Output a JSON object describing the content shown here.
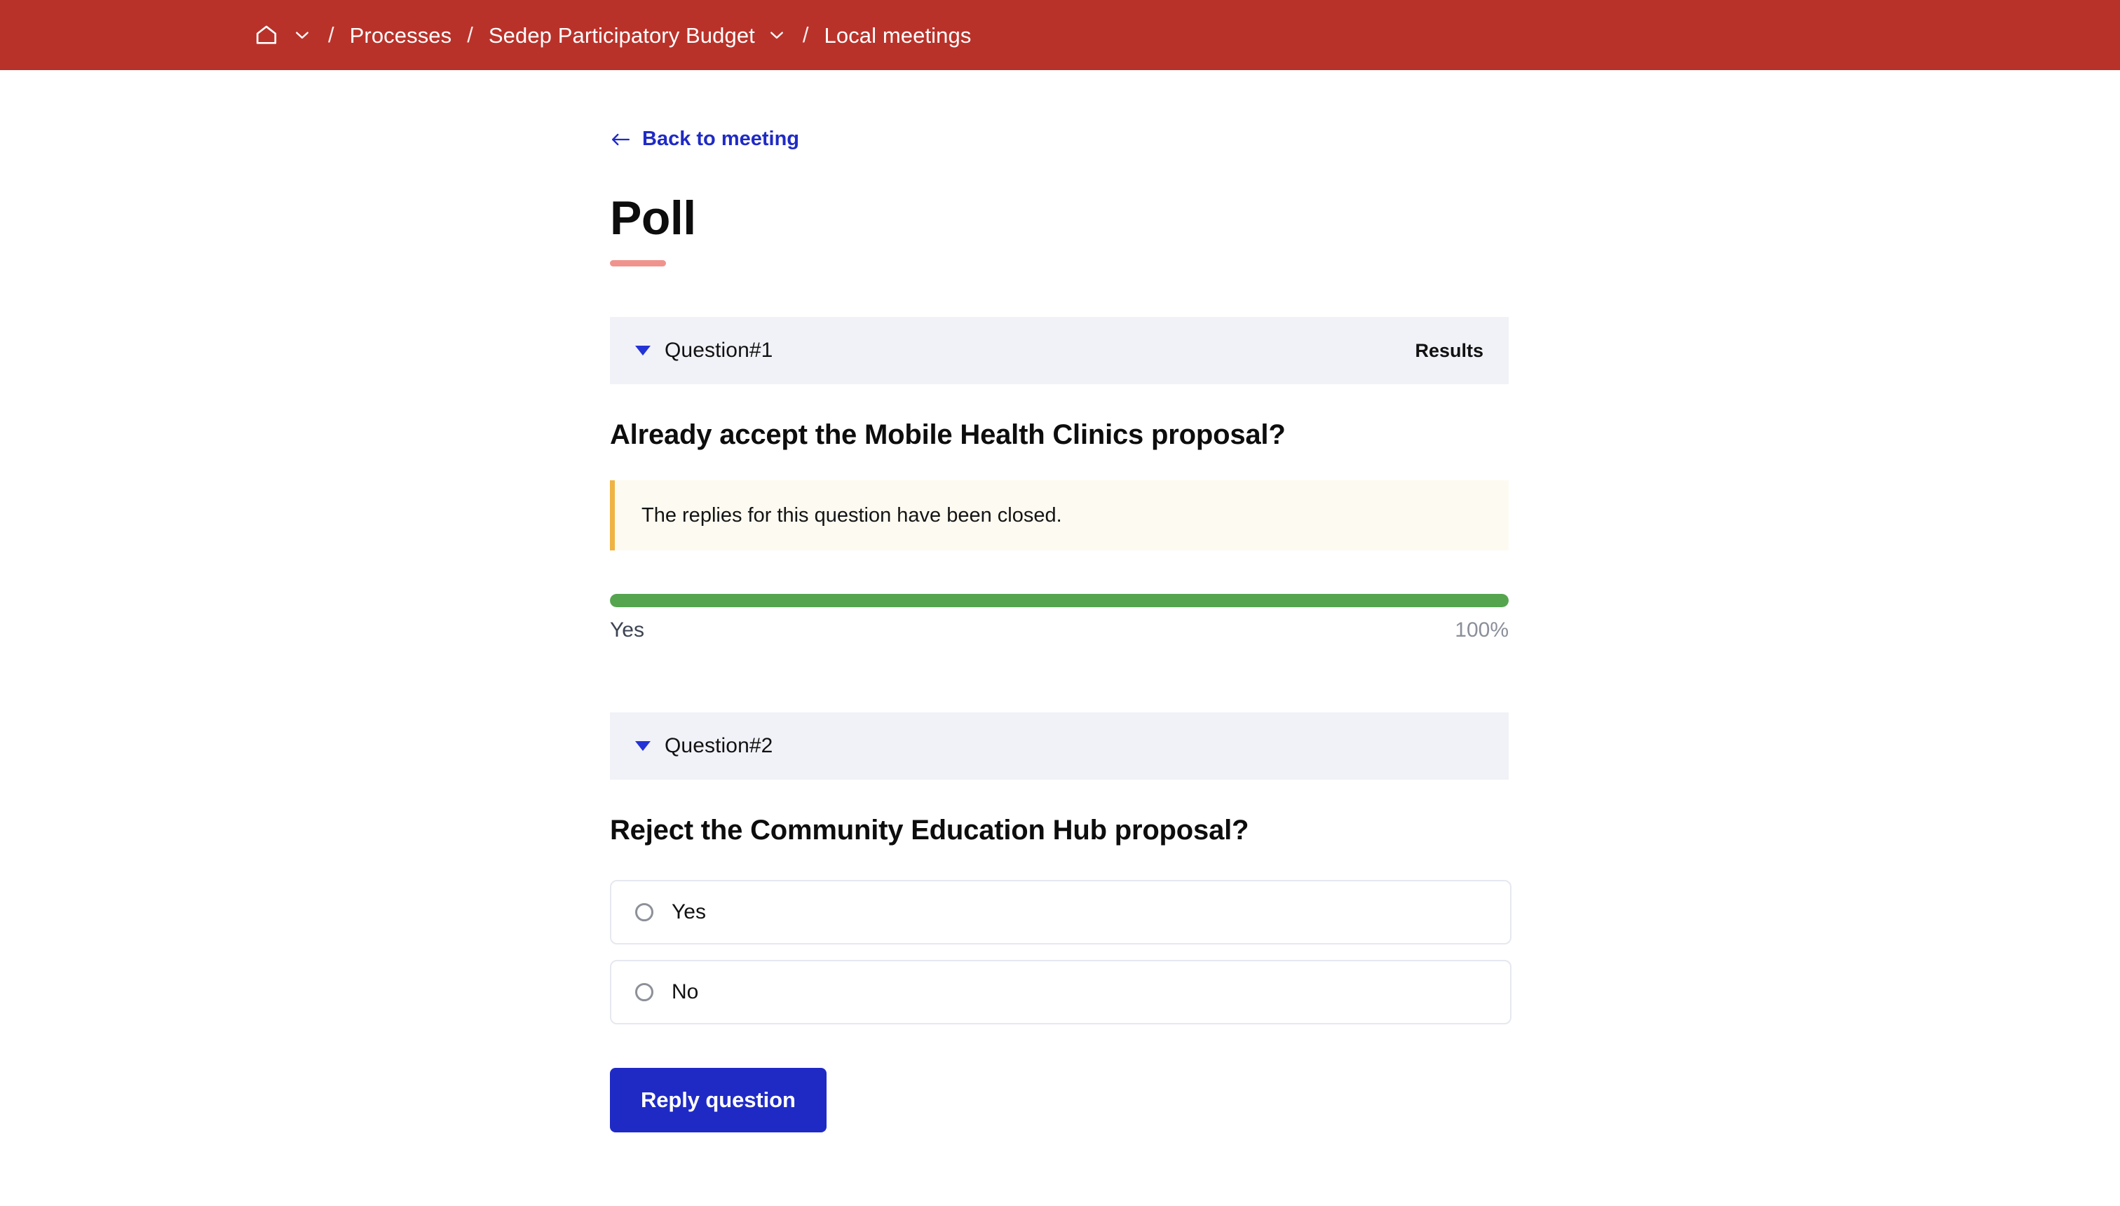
{
  "colors": {
    "nav_background": "#b9322a",
    "accent_link": "#1f2ac5",
    "title_rule": "#f0938c",
    "result_bar": "#55a54f",
    "callout_border": "#efb343",
    "callout_background": "#fdfaf1",
    "question_header_background": "#f1f2f7",
    "primary_button": "#1f2ac5"
  },
  "navbar": {
    "home_icon": "home-icon",
    "home_dropdown_icon": "chevron-down-icon",
    "separator": "/",
    "items": [
      {
        "label": "Processes",
        "has_dropdown": false
      },
      {
        "label": "Sedep Participatory Budget",
        "has_dropdown": true
      },
      {
        "label": "Local meetings",
        "has_dropdown": false
      }
    ]
  },
  "main": {
    "back_link": {
      "label": "Back to meeting",
      "icon": "arrow-left-icon"
    },
    "title": "Poll",
    "questions": [
      {
        "collapse_icon": "triangle-down-icon",
        "number_label": "Question#1",
        "results_label": "Results",
        "title": "Already accept the Mobile Health Clinics proposal?",
        "notice": "The replies for this question have been closed.",
        "results": [
          {
            "option": "Yes",
            "percent_label": "100%",
            "percent": 100
          }
        ]
      },
      {
        "collapse_icon": "triangle-down-icon",
        "number_label": "Question#2",
        "results_label": "",
        "title": "Reject the Community Education Hub proposal?",
        "options": [
          {
            "label": "Yes",
            "selected": false
          },
          {
            "label": "No",
            "selected": false
          }
        ],
        "submit_label": "Reply question"
      }
    ]
  }
}
